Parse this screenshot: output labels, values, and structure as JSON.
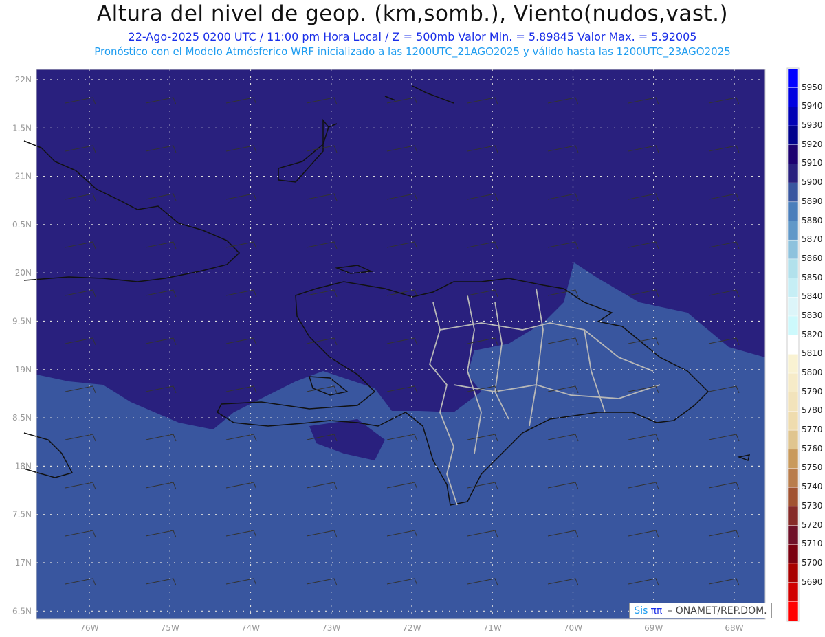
{
  "header": {
    "title": "Altura del nivel de geop. (km,somb.), Viento(nudos,vast.)",
    "subtitle": "22-Ago-2025  0200 UTC / 11:00 pm Hora Local / Z = 500mb    Valor Min. = 5.89845   Valor Max. = 5.92005",
    "forecast_line": "Pronóstico con el Modelo Atmósferico WRF inicializado a las 1200UTC_21AGO2025 y válido hasta las  1200UTC_23AGO2025"
  },
  "axes": {
    "lat_labels": [
      "22N",
      "1.5N",
      "21N",
      "0.5N",
      "20N",
      "9.5N",
      "19N",
      "8.5N",
      "18N",
      "7.5N",
      "17N",
      "6.5N"
    ],
    "lon_labels": [
      "76W",
      "75W",
      "74W",
      "73W",
      "72W",
      "71W",
      "70W",
      "69W",
      "68W"
    ]
  },
  "colorbar": {
    "levels": [
      "5950",
      "5940",
      "5930",
      "5920",
      "5910",
      "5900",
      "5890",
      "5880",
      "5870",
      "5860",
      "5850",
      "5840",
      "5830",
      "5820",
      "5810",
      "5800",
      "5790",
      "5780",
      "5770",
      "5760",
      "5750",
      "5740",
      "5730",
      "5720",
      "5710",
      "5700",
      "5690"
    ],
    "colors": [
      "#0000ff",
      "#0000e0",
      "#0000b4",
      "#00008c",
      "#1c0070",
      "#29207e",
      "#39569f",
      "#4a7ebb",
      "#6198c8",
      "#8ec2dd",
      "#b2e1ec",
      "#c6eef5",
      "#dcf5f9",
      "#cdf9fc",
      "#ffffff",
      "#f9f2d2",
      "#f6ebc8",
      "#f2e3bb",
      "#efdcae",
      "#e0c58f",
      "#c99a5c",
      "#b97d4c",
      "#a15231",
      "#862a28",
      "#6f1028",
      "#7a0010",
      "#a80000",
      "#d00000",
      "#ff0000"
    ]
  },
  "map_colors": {
    "north": "#29207e",
    "south": "#39569f",
    "south_alt": "#4a72b0"
  },
  "logo": {
    "brand": "Sis",
    "pi": "ππ",
    "text": "– ONAMET/REP.DOM."
  }
}
